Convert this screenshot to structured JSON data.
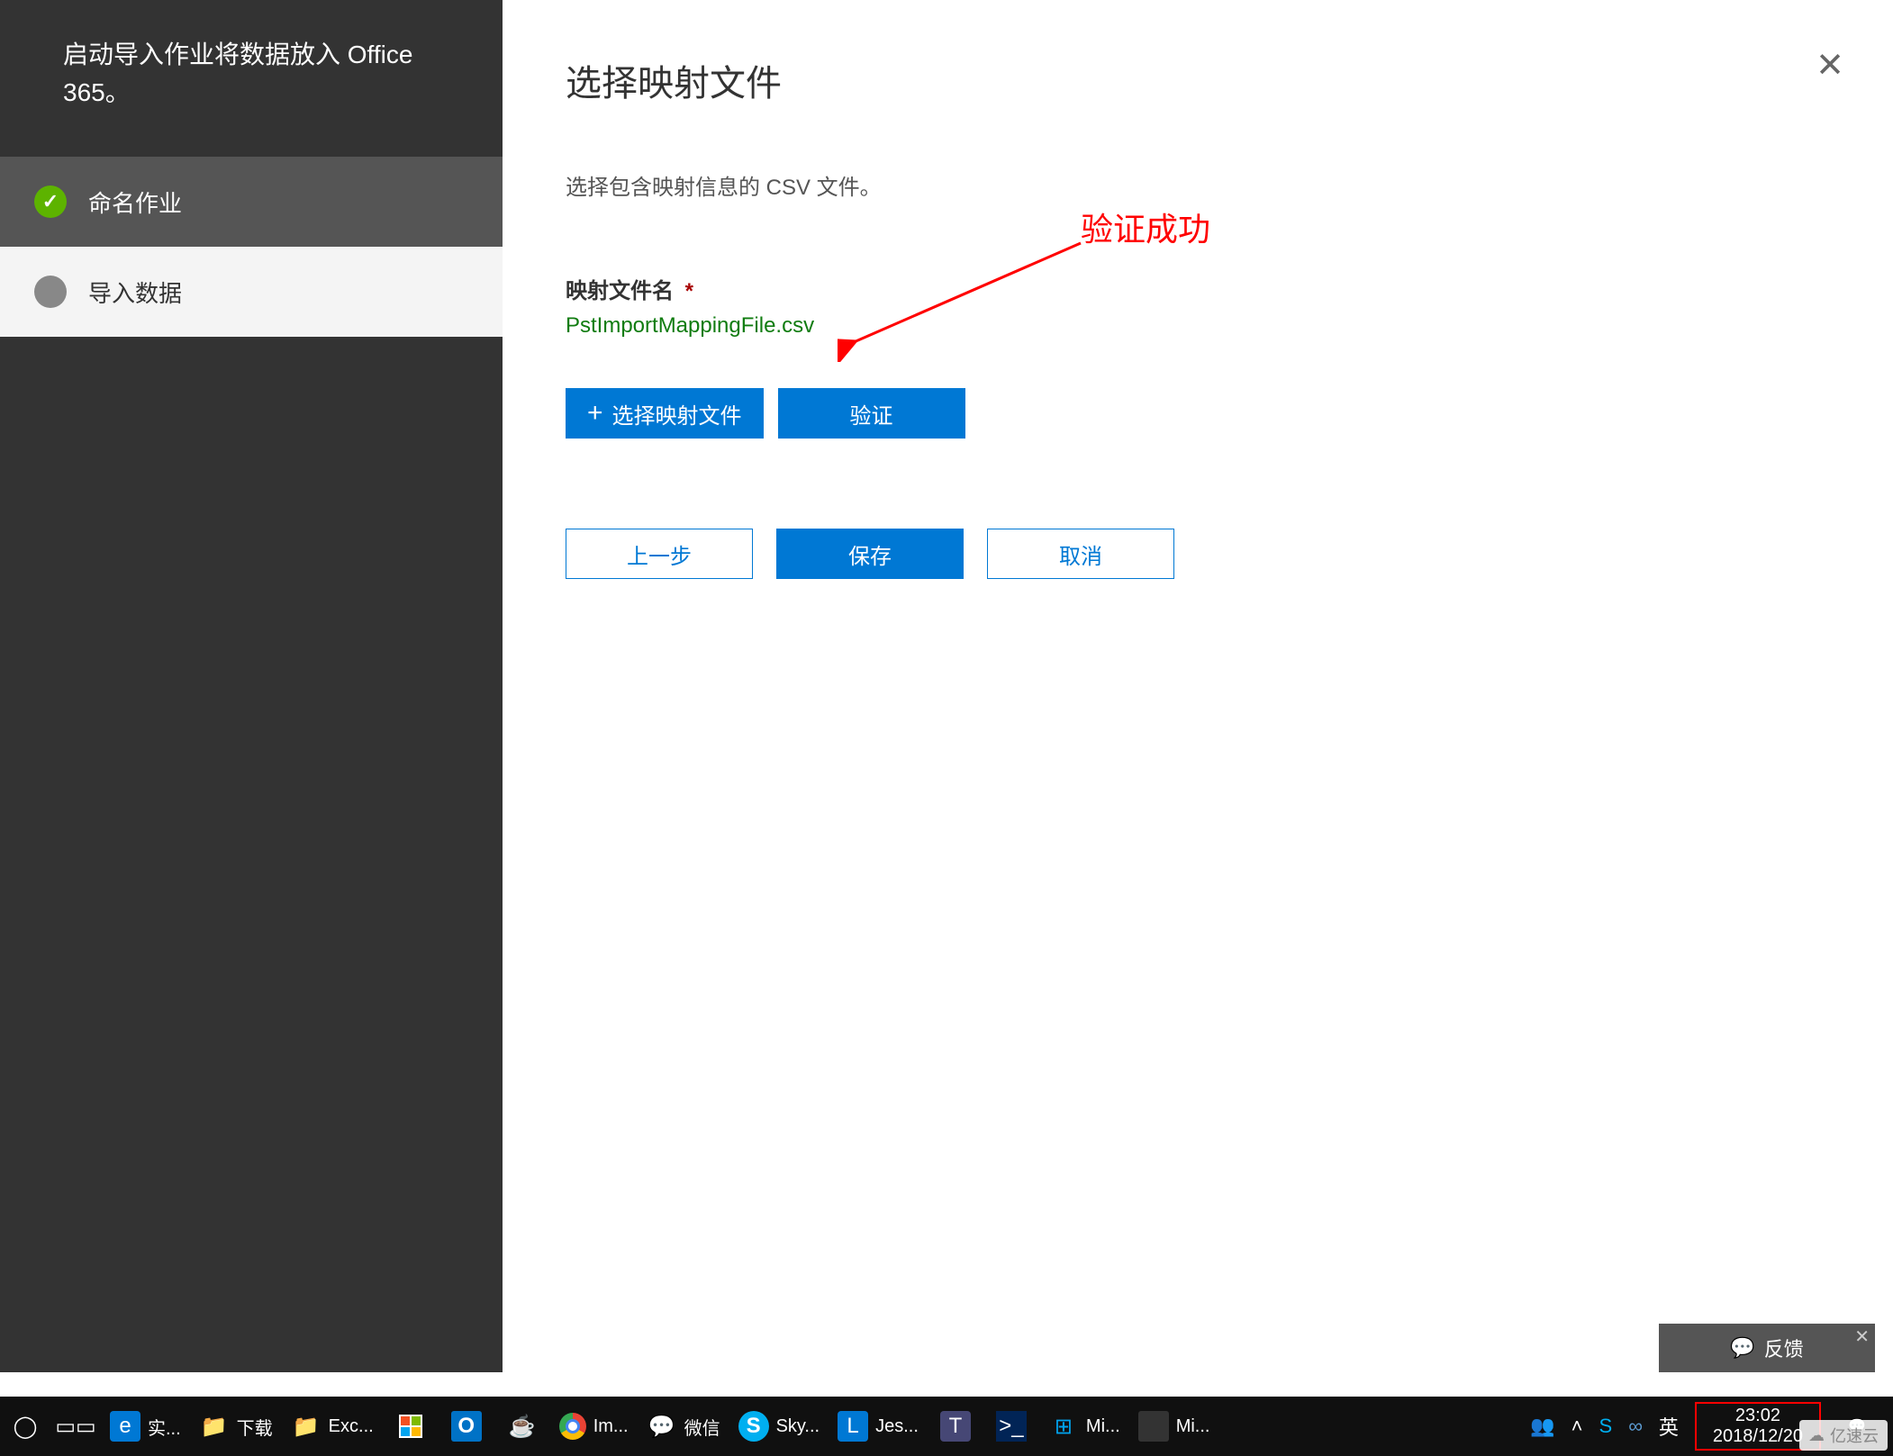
{
  "sidebar": {
    "wizard_title": "启动导入作业将数据放入 Office 365。",
    "steps": [
      {
        "label": "命名作业",
        "state": "done"
      },
      {
        "label": "导入数据",
        "state": "pending"
      }
    ]
  },
  "main": {
    "title": "选择映射文件",
    "instruction": "选择包含映射信息的 CSV 文件。",
    "field_label": "映射文件名",
    "required_mark": "*",
    "file_name": "PstImportMappingFile.csv",
    "buttons": {
      "select_mapping": "选择映射文件",
      "validate": "验证",
      "back": "上一步",
      "save": "保存",
      "cancel": "取消"
    },
    "annotation": "验证成功"
  },
  "feedback": {
    "label": "反馈"
  },
  "taskbar": {
    "items": [
      {
        "name": "cortana",
        "label": ""
      },
      {
        "name": "taskview",
        "label": ""
      },
      {
        "name": "edge",
        "label": "实..."
      },
      {
        "name": "folder1",
        "label": "下载"
      },
      {
        "name": "folder2",
        "label": "Exc..."
      },
      {
        "name": "store",
        "label": ""
      },
      {
        "name": "outlook",
        "label": ""
      },
      {
        "name": "java",
        "label": ""
      },
      {
        "name": "chrome",
        "label": "Im..."
      },
      {
        "name": "wechat",
        "label": "微信"
      },
      {
        "name": "skype",
        "label": "Sky..."
      },
      {
        "name": "lync",
        "label": "Jes..."
      },
      {
        "name": "teams",
        "label": ""
      },
      {
        "name": "powershell",
        "label": ""
      },
      {
        "name": "winterm",
        "label": "Mi..."
      },
      {
        "name": "servermgr",
        "label": "Mi..."
      }
    ],
    "tray": {
      "people_icon": "people",
      "chevron": "^",
      "skype": "S",
      "vscode": "vs",
      "ime": "英",
      "time": "23:02",
      "date": "2018/12/20"
    }
  },
  "watermark": "亿速云"
}
